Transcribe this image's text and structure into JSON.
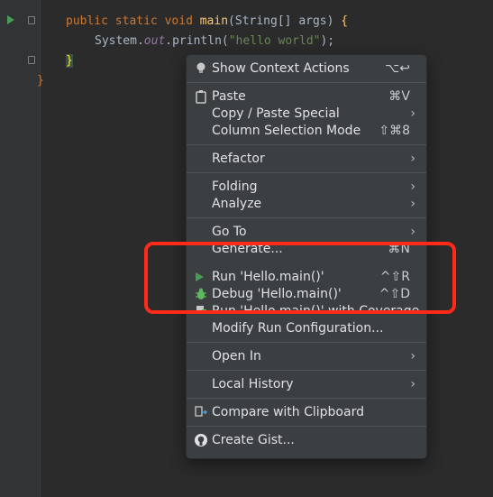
{
  "editor": {
    "line1": {
      "kw1": "public",
      "kw2": "static",
      "kw3": "void",
      "method": "main",
      "params_open": "(String[] args) ",
      "brace": "{"
    },
    "line2": {
      "prefix": "System.",
      "field": "out",
      "call": ".println(",
      "string": "\"hello world\"",
      "end": ");"
    },
    "line3": {
      "brace": "}"
    },
    "line4": {
      "brace": "}"
    }
  },
  "context_menu": {
    "show_context_actions": {
      "label": "Show Context Actions",
      "shortcut": "⌥↩"
    },
    "paste": {
      "label": "Paste",
      "shortcut": "⌘V"
    },
    "copy_paste_special": {
      "label": "Copy / Paste Special"
    },
    "column_selection_mode": {
      "label": "Column Selection Mode",
      "shortcut": "⇧⌘8"
    },
    "refactor": {
      "label": "Refactor"
    },
    "folding": {
      "label": "Folding"
    },
    "analyze": {
      "label": "Analyze"
    },
    "go_to": {
      "label": "Go To"
    },
    "generate": {
      "label": "Generate...",
      "shortcut": "⌘N"
    },
    "run": {
      "label": "Run 'Hello.main()'",
      "shortcut": "^⇧R"
    },
    "debug": {
      "label": "Debug 'Hello.main()'",
      "shortcut": "^⇧D"
    },
    "run_coverage": {
      "label": "Run 'Hello.main()' with Coverage"
    },
    "modify_run_config": {
      "label": "Modify Run Configuration..."
    },
    "open_in": {
      "label": "Open In"
    },
    "local_history": {
      "label": "Local History"
    },
    "compare_clipboard": {
      "label": "Compare with Clipboard"
    },
    "create_gist": {
      "label": "Create Gist..."
    },
    "submenu_arrow": "›"
  },
  "colors": {
    "annotation_border": "#ff2a1a",
    "run_green": "#499c54",
    "debug_green": "#5fb85f"
  }
}
